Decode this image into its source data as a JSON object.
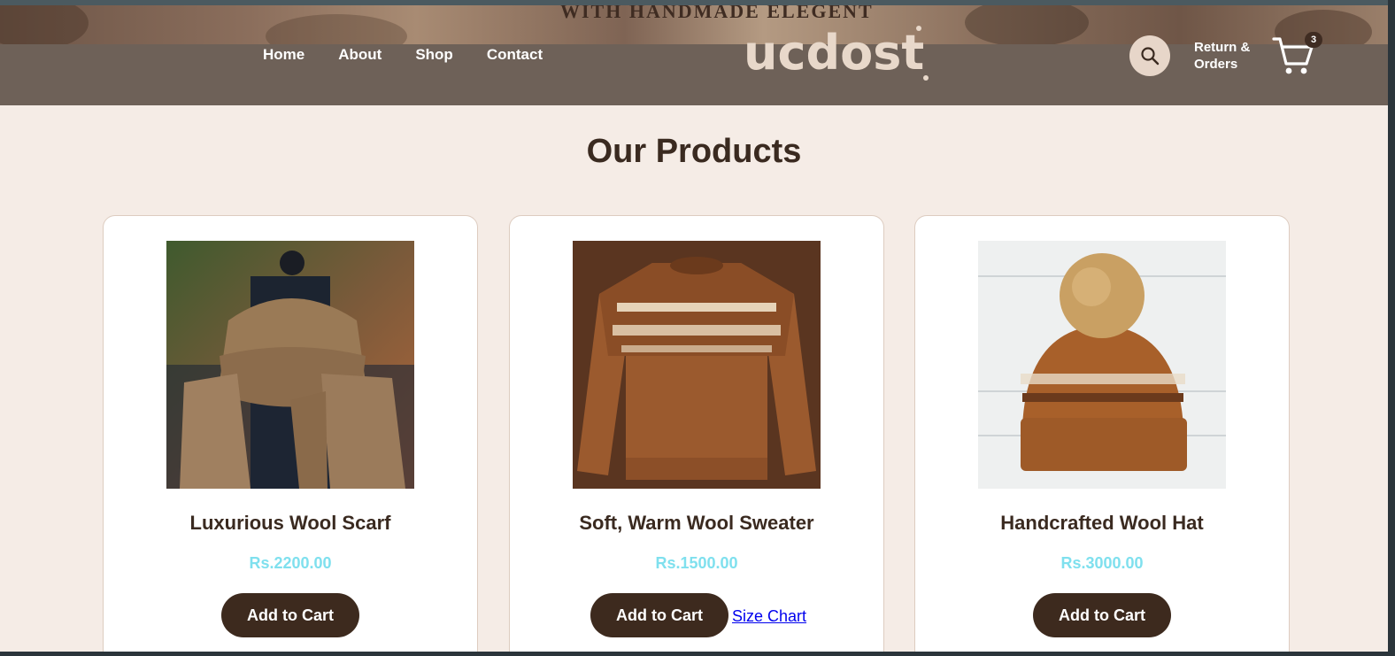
{
  "header": {
    "banner_text": "WITH HANDMADE ELEGENT",
    "nav": [
      {
        "label": "Home"
      },
      {
        "label": "About"
      },
      {
        "label": "Shop"
      },
      {
        "label": "Contact"
      }
    ],
    "logo_text": "ucdost",
    "returns_line1": "Return &",
    "returns_line2": "Orders",
    "cart_count": "3",
    "icons": {
      "search": "search-icon",
      "cart": "cart-icon"
    }
  },
  "main": {
    "title": "Our Products",
    "products": [
      {
        "name": "Luxurious Wool Scarf",
        "price": "Rs.2200.00",
        "button": "Add to Cart",
        "image": "wool-scarf-image"
      },
      {
        "name": "Soft, Warm Wool Sweater",
        "price": "Rs.1500.00",
        "button": "Add to Cart",
        "link": "Size Chart",
        "image": "wool-sweater-image"
      },
      {
        "name": "Handcrafted Wool Hat",
        "price": "Rs.3000.00",
        "button": "Add to Cart",
        "image": "wool-hat-image"
      }
    ]
  },
  "colors": {
    "navbar": "#6e6158",
    "page_bg": "#f5ece6",
    "heading": "#3a2a20",
    "price": "#7fe0ee",
    "button": "#3d2a1e"
  }
}
